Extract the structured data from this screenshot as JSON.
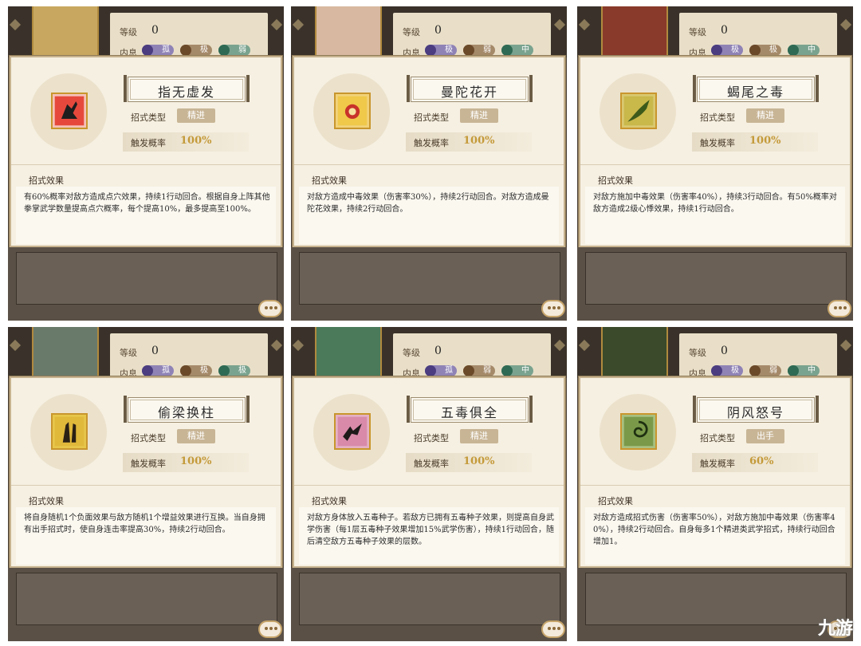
{
  "header": {
    "level_label": "等级",
    "level_value": "0",
    "neixi_label": "内息"
  },
  "card_labels": {
    "type_label": "招式类型",
    "rate_label": "触发概率",
    "effect_title": "招式效果"
  },
  "panels": [
    {
      "name": "指无虚发",
      "chips": [
        "孤",
        "极",
        "弱"
      ],
      "type": "精进",
      "rate": "100%",
      "effect": "有60%概率对敌方造成点穴效果，持续1行动回合。根据自身上阵其他拳掌武学数量提高点穴概率，每个提高10%，最多提高至100%。",
      "icon_color": "#d9463c"
    },
    {
      "name": "曼陀花开",
      "chips": [
        "极",
        "弱",
        "中"
      ],
      "type": "精进",
      "rate": "100%",
      "effect": "对敌方造成中毒效果（伤害率30%），持续2行动回合。对敌方造成曼陀花效果，持续2行动回合。",
      "icon_color": "#e2b63c"
    },
    {
      "name": "蝎尾之毒",
      "chips": [
        "极",
        "极",
        "中"
      ],
      "type": "精进",
      "rate": "100%",
      "effect": "对敌方施加中毒效果（伤害率40%），持续3行动回合。有50%概率对敌方造成2级心悸效果，持续1行动回合。",
      "icon_color": "#7a8c2c"
    },
    {
      "name": "偷梁换柱",
      "chips": [
        "孤",
        "极",
        "极"
      ],
      "type": "精进",
      "rate": "100%",
      "effect": "将自身随机1个负面效果与敌方随机1个增益效果进行互换。当自身拥有出手招式时，使自身连击率提高30%，持续2行动回合。",
      "icon_color": "#c9962d"
    },
    {
      "name": "五毒俱全",
      "chips": [
        "孤",
        "弱",
        "中"
      ],
      "type": "精进",
      "rate": "100%",
      "effect": "对敌方身体放入五毒种子。若敌方已拥有五毒种子效果，则提高自身武学伤害（每1层五毒种子效果增加15%武学伤害），持续1行动回合，随后清空敌方五毒种子效果的层数。",
      "icon_color": "#b05a8c"
    },
    {
      "name": "阴风怒号",
      "chips": [
        "极",
        "弱",
        "中"
      ],
      "type": "出手",
      "rate": "60%",
      "effect": "对敌方造成招式伤害（伤害率50%），对敌方施加中毒效果（伤害率40%），持续2行动回合。自身每多1个精进类武学招式，持续行动回合增加1。",
      "icon_color": "#5c8a3c"
    }
  ],
  "watermark": "九游"
}
